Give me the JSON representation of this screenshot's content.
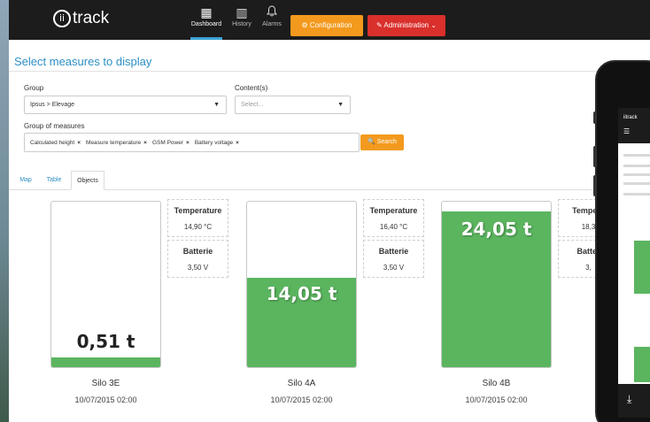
{
  "app": {
    "logo_mark": "ii",
    "logo_text": "track"
  },
  "nav": [
    {
      "label": "Dashboard",
      "icon": "grid-icon",
      "glyph": "▦"
    },
    {
      "label": "History",
      "icon": "bar-chart-icon",
      "glyph": "▥"
    },
    {
      "label": "Alarms",
      "icon": "bell-icon",
      "glyph": "🔔"
    }
  ],
  "buttons": {
    "configuration": "⚙ Configuration",
    "administration": "✎ Administration ⌄",
    "search": "🔍 Search"
  },
  "page": {
    "title": "Select measures to display"
  },
  "filters": {
    "group_label": "Group",
    "group_value": "Ipsus > Elevage",
    "contents_label": "Content(s)",
    "contents_placeholder": "Select...",
    "measures_label": "Group of measures",
    "tags": [
      "Calculated height",
      "Measure temperature",
      "GSM Power",
      "Battery voltage"
    ]
  },
  "tabs": [
    "Map",
    "Table",
    "Objects"
  ],
  "active_tab": "Objects",
  "silos": [
    {
      "name": "Silo 3E",
      "date": "10/07/2015 02:00",
      "weight": "0,51 t",
      "fill_fraction": 0.06,
      "measures": [
        {
          "name": "Temperature",
          "value": "14,90 °C"
        },
        {
          "name": "Batterie",
          "value": "3,50 V"
        }
      ]
    },
    {
      "name": "Silo 4A",
      "date": "10/07/2015 02:00",
      "weight": "14,05 t",
      "fill_fraction": 0.54,
      "measures": [
        {
          "name": "Temperature",
          "value": "16,40 °C"
        },
        {
          "name": "Batterie",
          "value": "3,50 V"
        }
      ]
    },
    {
      "name": "Silo 4B",
      "date": "10/07/2015 02:00",
      "weight": "24,05 t",
      "fill_fraction": 0.94,
      "measures": [
        {
          "name": "Tempera",
          "value": "18,3"
        },
        {
          "name": "Batter",
          "value": "3,"
        }
      ]
    }
  ],
  "colors": {
    "topbar": "#1c1c1c",
    "accent_blue": "#2d8fc4",
    "orange": "#f39a1e",
    "red": "#d9302c",
    "fill_green": "#5bb55f"
  },
  "phone": {
    "logo_text": "iitrack",
    "download_icon": "download-icon"
  }
}
